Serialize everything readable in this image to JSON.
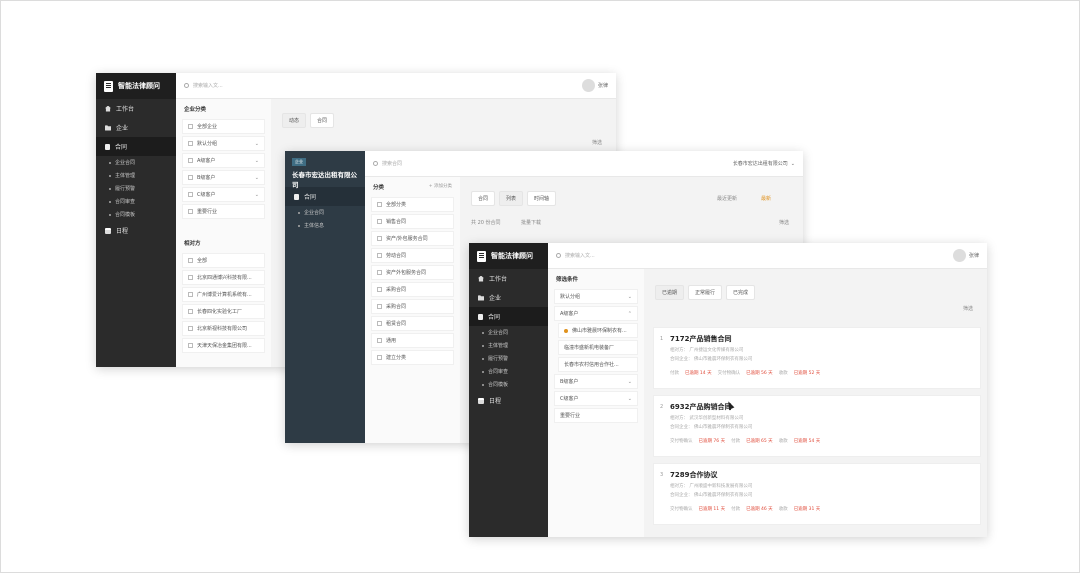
{
  "app_name": "智能法律顾问",
  "search_placeholder": "搜索输入文...",
  "user_name": "张律",
  "nav": {
    "workbench": "工作台",
    "enterprise": "企业",
    "contract": "合同",
    "contract_subs": [
      "企业合同",
      "主体管理",
      "履行预警",
      "合同审查",
      "合同模板"
    ],
    "calendar": "日程"
  },
  "win1": {
    "enterprise_panel_title": "企业分类",
    "enterprise_filters": [
      "全部企业",
      "默认分组",
      "A级客户",
      "B级客户",
      "C级客户",
      "重要行业"
    ],
    "counterparty_title": "相对方",
    "counterparties": [
      "全部",
      "北京四通博兴科技有限...",
      "广州博爱计算机系统有...",
      "长春四化实验化工厂",
      "北京新视科技有限公司",
      "天津天保冶金集团有限..."
    ],
    "tabs": [
      "动态",
      "合同"
    ],
    "filter_label": "筛选"
  },
  "win2": {
    "tag": "企业",
    "company": "长春市宏达出租有限公司",
    "side_items": [
      "合同",
      "企业合同",
      "主体信息"
    ],
    "search_placeholder": "搜索合同",
    "company_selector": "长春市宏达出租有限公司",
    "panel_title": "分类",
    "panel_action": "+ 添加分类",
    "categories": [
      "全部分类",
      "销售合同",
      "资产/外包服务合同",
      "劳动合同",
      "资产外包服务合同",
      "采购合同",
      "采购合同",
      "租赁合同",
      "通用",
      "建立分类"
    ],
    "tabs": [
      "合同",
      "列表",
      "时间轴"
    ],
    "sort_label": "最近更新",
    "sort_value": "最新",
    "count_text": "共 20 份合同",
    "bulk_download": "批量下载",
    "filter_label": "筛选"
  },
  "win3": {
    "panel_title": "筛选条件",
    "filters": [
      "默认分组",
      "A级客户",
      "B级客户",
      "C级客户",
      "重要行业"
    ],
    "sub_companies": [
      "佛山市雅晨环保制衣有...",
      "临潼市盛新机电装备厂",
      "长春市农村信用合作社..."
    ],
    "tabs": [
      "已逾期",
      "正常履行",
      "已完成"
    ],
    "filter_label": "筛选",
    "cards": [
      {
        "num": "1",
        "title": "7172产品销售合同",
        "line1": "相对方：  广州捷运文化传媒有限公司",
        "line2": "合同企业：  佛山市雅晨环保制衣有限公司",
        "stats": [
          "付款",
          "已逾期 14 天",
          "交付物确认",
          "已逾期 56 天",
          "收款",
          "已逾期 52 天"
        ]
      },
      {
        "num": "2",
        "title": "6932产品购销合同",
        "line1": "相对方：  武汉华创新型材料有限公司",
        "line2": "合同企业：  佛山市雅晨环保制衣有限公司",
        "stats": [
          "交付物确认",
          "已逾期 76 天",
          "付款",
          "已逾期 65 天",
          "收款",
          "已逾期 54 天"
        ]
      },
      {
        "num": "3",
        "title": "7289合作协议",
        "line1": "相对方：  广州顺盛中新科技发展有限公司",
        "line2": "合同企业：  佛山市雅晨环保制衣有限公司",
        "stats": [
          "交付物确认",
          "已逾期 11 天",
          "付款",
          "已逾期 46 天",
          "收款",
          "已逾期 31 天"
        ]
      }
    ]
  }
}
